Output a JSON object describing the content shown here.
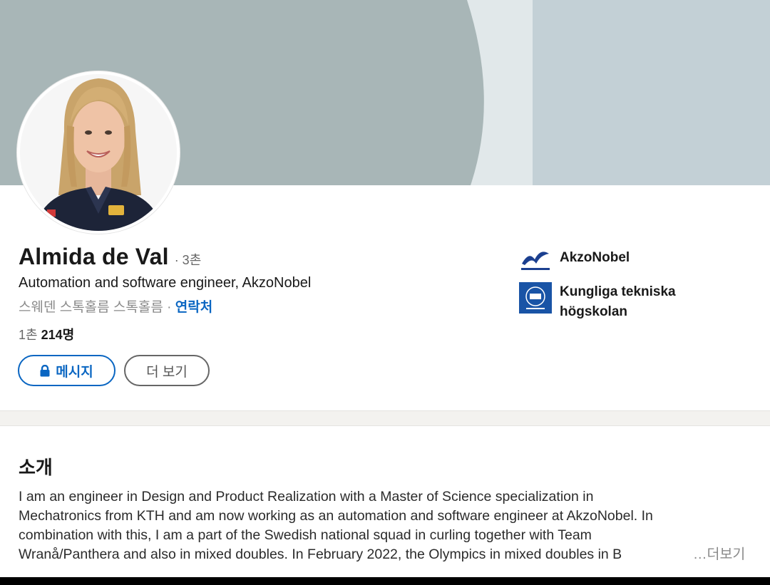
{
  "profile": {
    "name": "Almida de Val",
    "degree": "· 3촌",
    "headline": "Automation and software engineer, AkzoNobel",
    "location": "스웨덴 스톡홀름 스톡홀름 ·",
    "contact_label": "연락처",
    "connections_prefix": "1촌",
    "connections_count": "214명"
  },
  "actions": {
    "message_label": "메시지",
    "more_label": "더 보기"
  },
  "organizations": [
    {
      "name": "AkzoNobel",
      "logo_icon": "akzonobel-logo"
    },
    {
      "name": "Kungliga tekniska högskolan",
      "logo_icon": "kth-logo"
    }
  ],
  "about": {
    "title": "소개",
    "lines": [
      "I am an engineer in Design and Product Realization with a Master of Science specialization in",
      "Mechatronics from KTH and am now working as an automation and software engineer at AkzoNobel. In",
      "combination with this, I am a part of the Swedish national squad in curling together with Team",
      "Wranå/Panthera and also in mixed doubles. In February 2022, the Olympics in mixed doubles in B"
    ],
    "see_more": "…더보기"
  },
  "colors": {
    "accent": "#0a66c2",
    "banner_dark": "#a8b6b7",
    "banner_light": "#c2d0d5",
    "text": "#191919",
    "muted": "#666666"
  }
}
